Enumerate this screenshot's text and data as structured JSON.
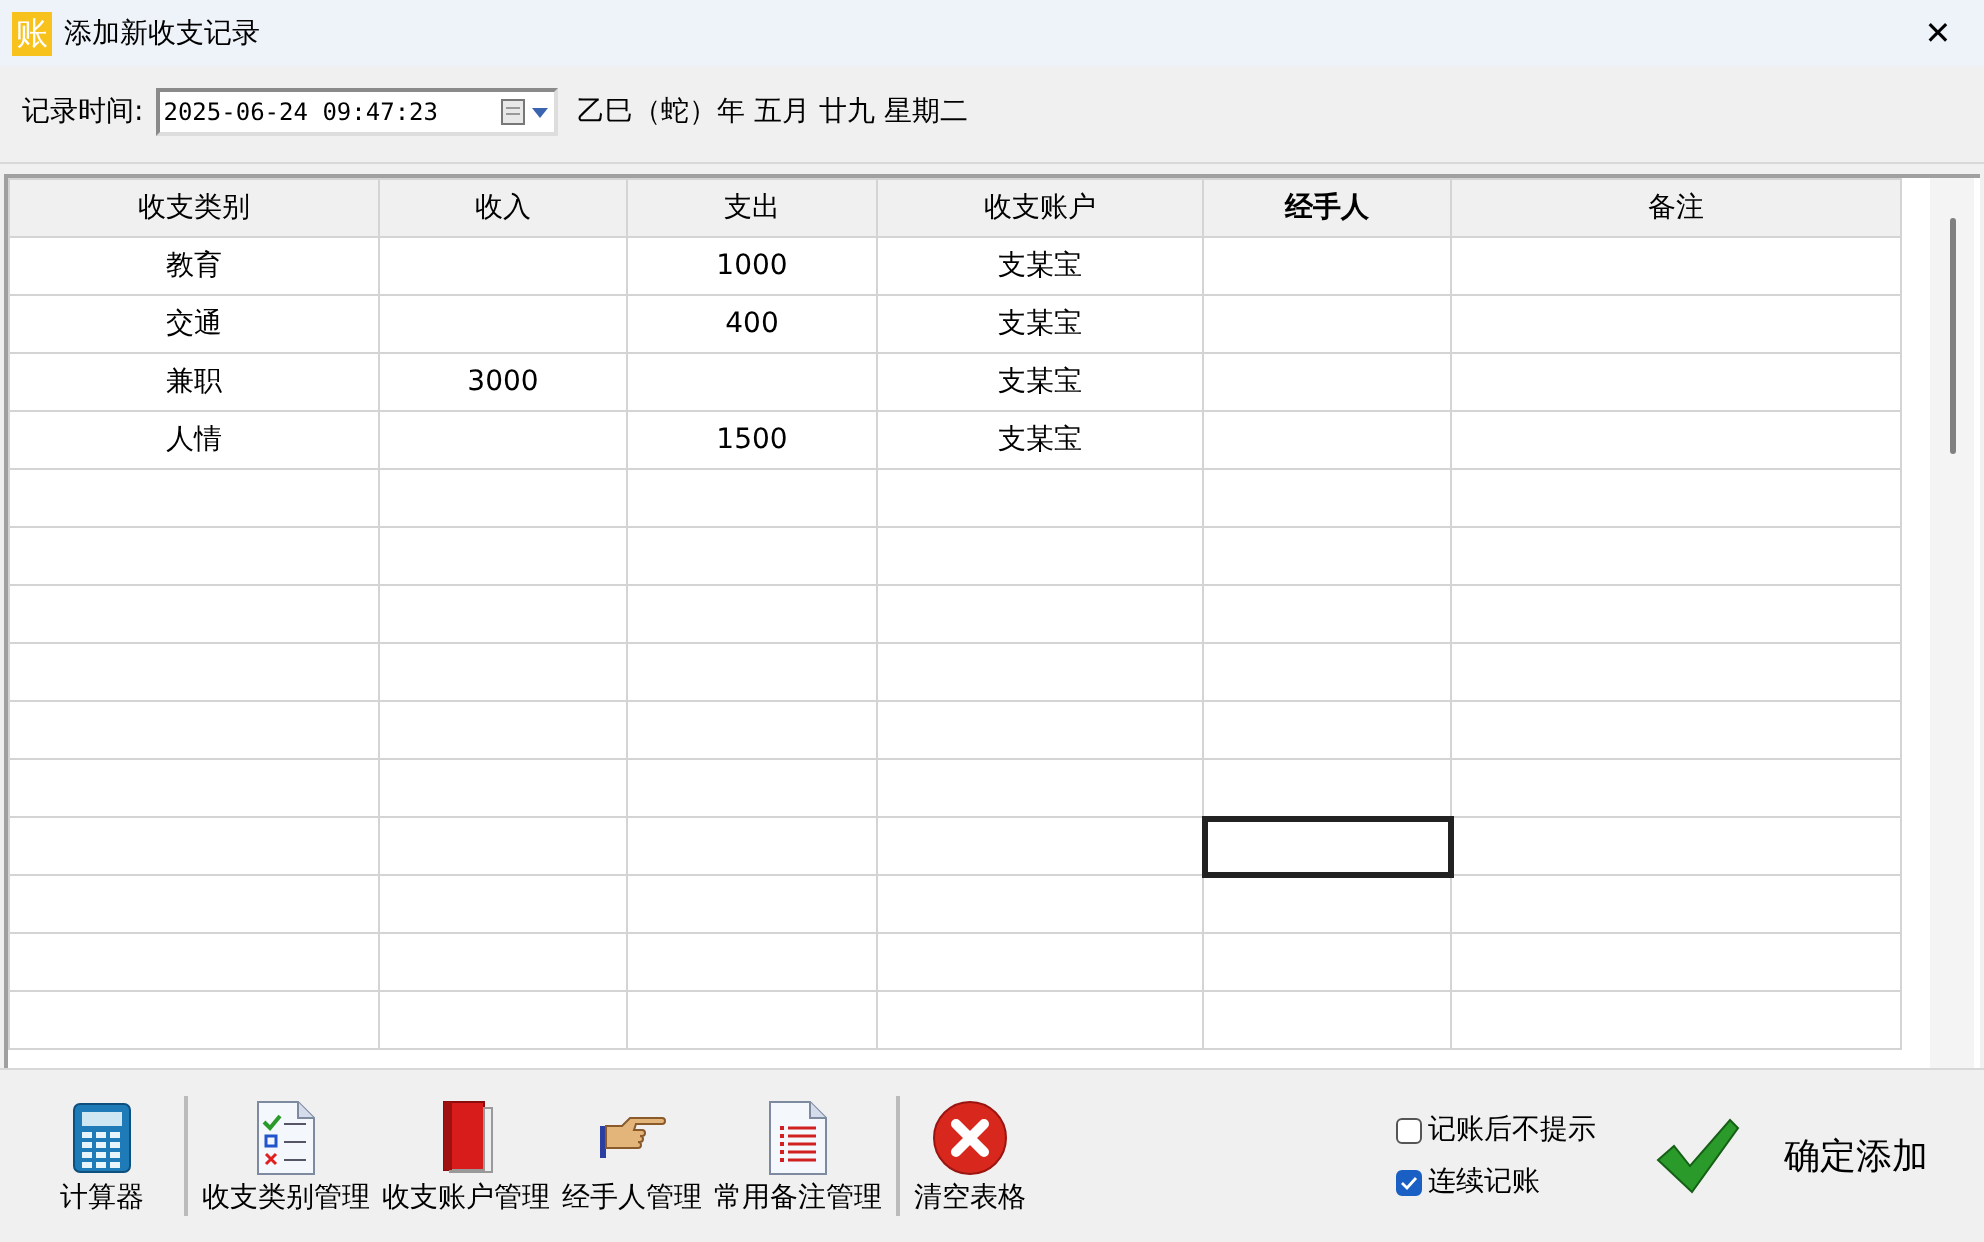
{
  "window": {
    "icon_glyph": "账",
    "title": "添加新收支记录",
    "close": "✕"
  },
  "record_time": {
    "label": "记录时间:",
    "value": "2025-06-24 09:47:23",
    "lunar": "乙巳（蛇）年 五月 廿九 星期二"
  },
  "table": {
    "columns": [
      {
        "label": "收支类别",
        "selected": false
      },
      {
        "label": "收入",
        "selected": false
      },
      {
        "label": "支出",
        "selected": false
      },
      {
        "label": "收支账户",
        "selected": false
      },
      {
        "label": "经手人",
        "selected": true
      },
      {
        "label": "备注",
        "selected": false
      }
    ],
    "rows": [
      {
        "focused": false,
        "cells": [
          {
            "text": "教育"
          },
          {},
          {
            "text": "1000"
          },
          {
            "text": "支某宝"
          },
          {},
          {}
        ]
      },
      {
        "focused": false,
        "cells": [
          {
            "text": "交通"
          },
          {},
          {
            "text": "400"
          },
          {
            "text": "支某宝"
          },
          {},
          {}
        ]
      },
      {
        "focused": false,
        "cells": [
          {
            "text": "兼职"
          },
          {
            "text": "3000"
          },
          {},
          {
            "text": "支某宝"
          },
          {},
          {}
        ]
      },
      {
        "focused": false,
        "cells": [
          {
            "text": "人情"
          },
          {},
          {
            "text": "1500"
          },
          {
            "text": "支某宝"
          },
          {},
          {}
        ]
      },
      {
        "focused": false,
        "cells": []
      },
      {
        "focused": false,
        "cells": []
      },
      {
        "focused": false,
        "cells": []
      },
      {
        "focused": false,
        "cells": []
      },
      {
        "focused": false,
        "cells": []
      },
      {
        "focused": false,
        "cells": []
      },
      {
        "focused": true,
        "cells": []
      },
      {
        "focused": false,
        "cells": []
      },
      {
        "focused": false,
        "cells": []
      },
      {
        "focused": false,
        "cells": []
      }
    ]
  },
  "toolbar": [
    {
      "kind": "calculator",
      "label": "计算器"
    },
    {
      "kind": "separator"
    },
    {
      "kind": "checklist",
      "label": "收支类别管理"
    },
    {
      "kind": "book",
      "label": "收支账户管理"
    },
    {
      "kind": "hand",
      "label": "经手人管理"
    },
    {
      "kind": "document",
      "label": "常用备注管理"
    },
    {
      "kind": "separator"
    },
    {
      "kind": "clear",
      "label": "清空表格"
    }
  ],
  "options": [
    {
      "label": "记账后不提示",
      "checked": false
    },
    {
      "label": "连续记账",
      "checked": true
    }
  ],
  "confirm_button": {
    "label": "确定添加"
  }
}
